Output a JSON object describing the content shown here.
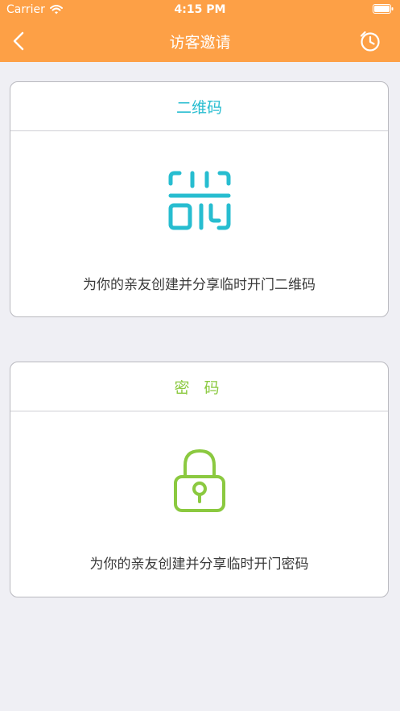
{
  "status_bar": {
    "carrier": "Carrier",
    "time": "4:15 PM"
  },
  "nav": {
    "title": "访客邀请",
    "back_icon": "chevron-left-icon",
    "history_icon": "clock-history-icon"
  },
  "colors": {
    "header": "#fda046",
    "qr_accent": "#27bdd0",
    "password_accent": "#8bc940",
    "background": "#efeff4"
  },
  "cards": [
    {
      "title": "二维码",
      "icon": "qr-code-icon",
      "description": "为你的亲友创建并分享临时开门二维码"
    },
    {
      "title": "密 码",
      "icon": "lock-icon",
      "description": "为你的亲友创建并分享临时开门密码"
    }
  ]
}
